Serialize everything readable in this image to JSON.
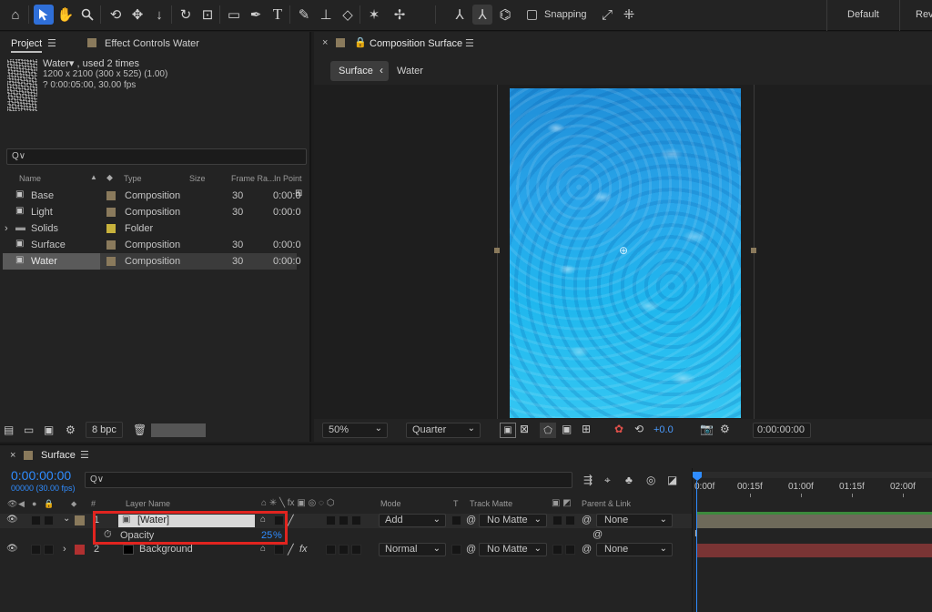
{
  "toolbar": {
    "snapping_label": "Snapping",
    "workspace_default": "Default",
    "workspace_review": "Revi"
  },
  "project": {
    "tab_project": "Project",
    "tab_effect_controls": "Effect Controls Water",
    "asset_name": "Water▾ , used 2 times",
    "asset_dims": "1200 x 2100  (300 x 525) (1.00)",
    "asset_duration": "? 0:00:05:00, 30.00 fps",
    "search_icon_text": "Q∨",
    "columns": {
      "name": "Name",
      "type": "Type",
      "size": "Size",
      "frame_rate": "Frame Ra...",
      "in_point": "In Point"
    },
    "items": [
      {
        "name": "Base",
        "type": "Composition",
        "frame_rate": "30",
        "in_point": "0:00:0",
        "color": "#8a7a5c"
      },
      {
        "name": "Light",
        "type": "Composition",
        "frame_rate": "30",
        "in_point": "0:00:0",
        "color": "#8a7a5c"
      },
      {
        "name": "Solids",
        "type": "Folder",
        "frame_rate": "",
        "in_point": "",
        "color": "#c8b23c"
      },
      {
        "name": "Surface",
        "type": "Composition",
        "frame_rate": "30",
        "in_point": "0:00:0",
        "color": "#8a7a5c"
      },
      {
        "name": "Water",
        "type": "Composition",
        "frame_rate": "30",
        "in_point": "0:00:0",
        "color": "#8a7a5c"
      }
    ],
    "bpc_label": "8 bpc"
  },
  "composition": {
    "tab_title": "Composition Surface",
    "breadcrumb_active": "Surface",
    "breadcrumb_child": "Water",
    "zoom": "50%",
    "resolution": "Quarter",
    "exposure": "+0.0",
    "timecode": "0:00:00:00"
  },
  "timeline": {
    "tab_title": "Surface",
    "current_time": "0:00:00:00",
    "frame_info": "00000 (30.00 fps)",
    "search_icon_text": "Q∨",
    "ruler_marks": [
      "0:00f",
      "00:15f",
      "01:00f",
      "01:15f",
      "02:00f"
    ],
    "columns": {
      "num": "#",
      "layer_name": "Layer Name",
      "mode": "Mode",
      "t": "T",
      "track_matte": "Track Matte",
      "parent_link": "Parent & Link"
    },
    "layers": [
      {
        "num": "1",
        "name": "[Water]",
        "mode": "Add",
        "matte": "No Matte",
        "parent": "None",
        "color": "#8a7a5c"
      },
      {
        "num": "2",
        "name": "Background",
        "mode": "Normal",
        "matte": "No Matte",
        "parent": "None",
        "color": "#b03030"
      }
    ],
    "opacity_label": "Opacity",
    "opacity_value": "25",
    "opacity_unit": "%",
    "bar_colors": {
      "layer1": "#6e6a5a",
      "layer2": "#7a3434",
      "highlight": "#e1241f",
      "accent": "#2f8cff"
    }
  }
}
